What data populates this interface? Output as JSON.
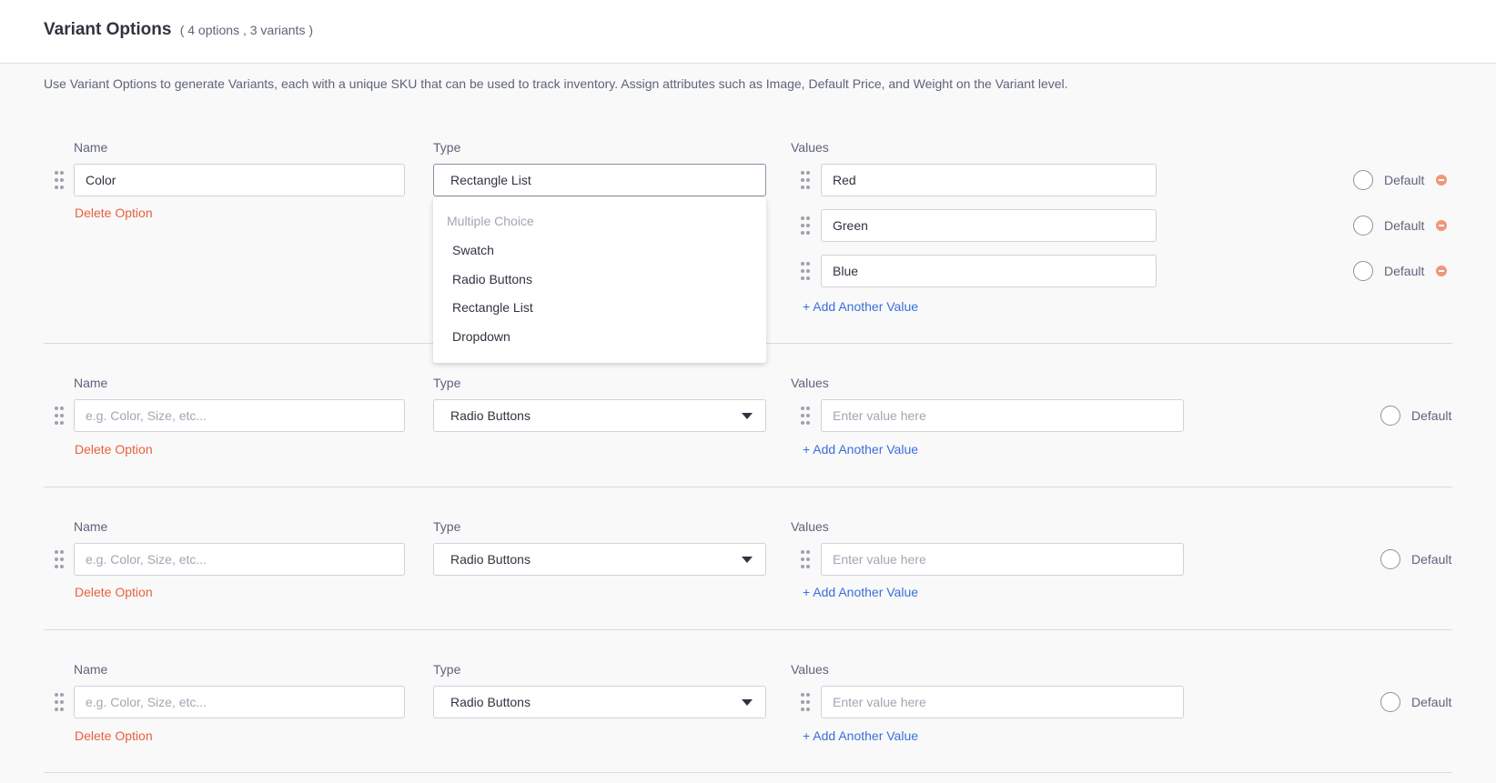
{
  "header": {
    "title": "Variant Options",
    "count": "( 4 options , 3 variants )"
  },
  "description": "Use Variant Options to generate Variants, each with a unique SKU that can be used to track inventory. Assign attributes such as Image, Default Price, and Weight on the Variant level.",
  "labels": {
    "name": "Name",
    "type": "Type",
    "values": "Values",
    "default": "Default",
    "delete_option": "Delete Option",
    "add_value": "+ Add Another Value",
    "name_placeholder": "e.g. Color, Size, etc...",
    "value_placeholder": "Enter value here"
  },
  "options": [
    {
      "name": "Color",
      "type": "Rectangle List",
      "values": [
        "Red",
        "Green",
        "Blue"
      ]
    },
    {
      "name": "",
      "type": "Radio Buttons",
      "values": [
        ""
      ]
    },
    {
      "name": "",
      "type": "Radio Buttons",
      "values": [
        ""
      ]
    },
    {
      "name": "",
      "type": "Radio Buttons",
      "values": [
        ""
      ]
    }
  ],
  "type_dropdown": {
    "group": "Multiple Choice",
    "items": [
      "Swatch",
      "Radio Buttons",
      "Rectangle List",
      "Dropdown"
    ]
  },
  "colors": {
    "delete": "#e8603c",
    "add": "#3a6fd8",
    "remove": "#f0967a"
  }
}
